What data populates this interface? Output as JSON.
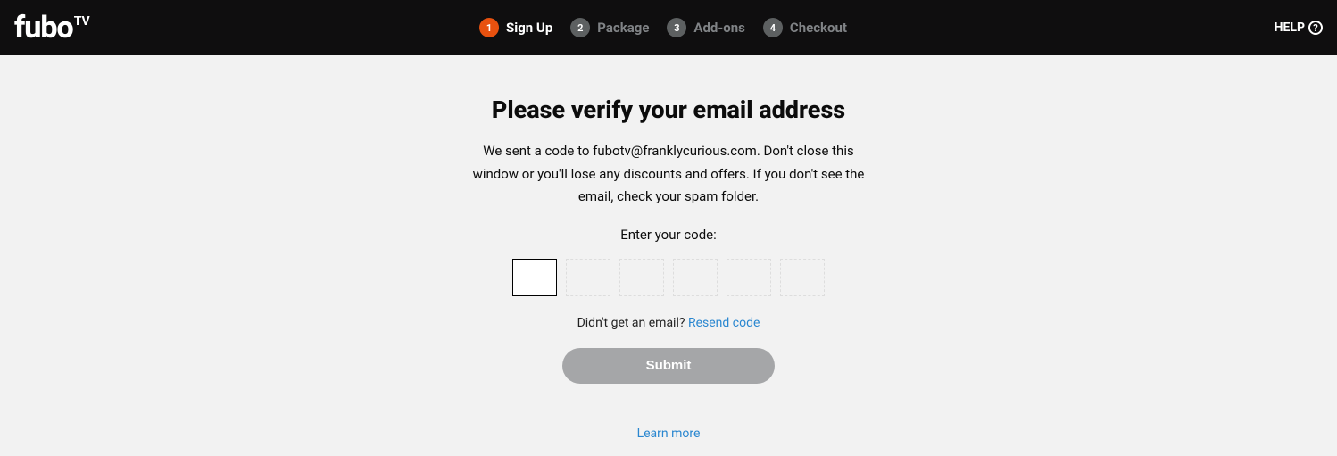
{
  "header": {
    "logo_main": "fubo",
    "logo_tv": "TV",
    "help": "HELP",
    "steps": [
      {
        "num": "1",
        "label": "Sign Up",
        "active": true
      },
      {
        "num": "2",
        "label": "Package",
        "active": false
      },
      {
        "num": "3",
        "label": "Add-ons",
        "active": false
      },
      {
        "num": "4",
        "label": "Checkout",
        "active": false
      }
    ]
  },
  "main": {
    "title": "Please verify your email address",
    "description": "We sent a code to fubotv@franklycurious.com. Don't close this window or you'll lose any discounts and offers. If you don't see the email, check your spam folder.",
    "enter_label": "Enter your code:",
    "didnt_get": "Didn't get an email? ",
    "resend": "Resend code",
    "submit": "Submit",
    "learn_more": "Learn more"
  }
}
